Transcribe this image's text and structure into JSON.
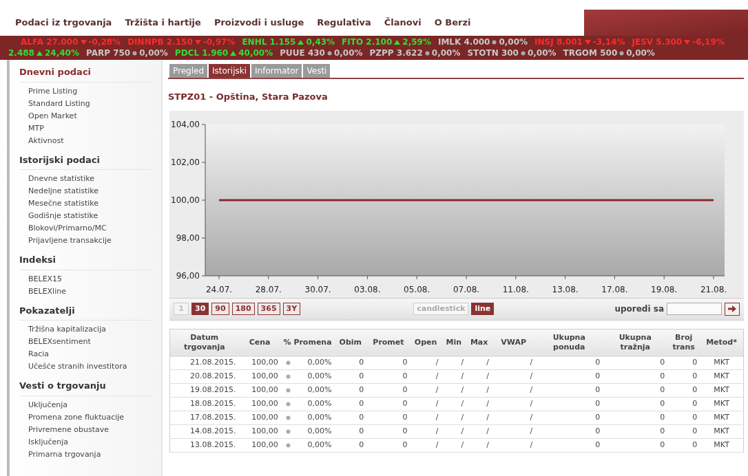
{
  "nav": [
    "Podaci iz trgovanja",
    "Tržišta i hartije",
    "Proizvodi i usluge",
    "Regulativa",
    "Članovi",
    "O Berzi"
  ],
  "ticker": [
    [
      {
        "name": "ALFA",
        "price": "27.000",
        "kind": "down",
        "change": "-0,28%"
      },
      {
        "name": "DINNPB",
        "price": "2.150",
        "kind": "down",
        "change": "-0,97%"
      },
      {
        "name": "ENHL",
        "price": "1.155",
        "kind": "up",
        "change": "0,43%"
      },
      {
        "name": "FITO",
        "price": "2.100",
        "kind": "up",
        "change": "2,59%"
      },
      {
        "name": "IMLK",
        "price": "4.000",
        "kind": "flat",
        "change": "0,00%"
      },
      {
        "name": "INSJ",
        "price": "8.001",
        "kind": "down",
        "change": "-3,14%"
      },
      {
        "name": "JESV",
        "price": "5.300",
        "kind": "down",
        "change": "-6,19%"
      }
    ],
    [
      {
        "price": "2.488",
        "kind": "up",
        "change": "24,40%"
      },
      {
        "name": "PARP",
        "price": "750",
        "kind": "flat",
        "change": "0,00%"
      },
      {
        "name": "PDCL",
        "price": "1.960",
        "kind": "up",
        "change": "40,00%"
      },
      {
        "name": "PUUE",
        "price": "430",
        "kind": "flat",
        "change": "0,00%"
      },
      {
        "name": "PZPP",
        "price": "3.622",
        "kind": "flat",
        "change": "0,00%"
      },
      {
        "name": "STOTN",
        "price": "300",
        "kind": "flat",
        "change": "0,00%"
      },
      {
        "name": "TRGOM",
        "price": "500",
        "kind": "flat",
        "change": "0,00%"
      }
    ]
  ],
  "sidebar": [
    {
      "title": "Dnevni podaci",
      "selected": true,
      "items": [
        "Prime Listing",
        "Standard Listing",
        "Open Market",
        "MTP",
        "Aktivnost"
      ]
    },
    {
      "title": "Istorijski podaci",
      "selected": false,
      "items": [
        "Dnevne statistike",
        "Nedeljne statistike",
        "Mesečne statistike",
        "Godišnje statistike",
        "Blokovi/Primarno/MC",
        "Prijavljene transakcije"
      ]
    },
    {
      "title": "Indeksi",
      "selected": false,
      "items": [
        "BELEX15",
        "BELEXline"
      ]
    },
    {
      "title": "Pokazatelji",
      "selected": false,
      "items": [
        "Tržišna kapitalizacija",
        "BELEXsentiment",
        "Racia",
        "Učešće stranih investitora"
      ]
    },
    {
      "title": "Vesti o trgovanju",
      "selected": false,
      "items": [
        "Uključenja",
        "Promena zone fluktuacije",
        "Privremene obustave",
        "Isključenja",
        "Primarna trgovanja"
      ]
    }
  ],
  "tabs": [
    {
      "label": "Pregled",
      "selected": false
    },
    {
      "label": "Istorijski",
      "selected": true
    },
    {
      "label": "Informator",
      "selected": false
    },
    {
      "label": "Vesti",
      "selected": false
    }
  ],
  "title": "STPZ01 - Opština, Stara Pazova",
  "chart": {
    "chart_data": {
      "type": "line",
      "categories": [
        "24.07.",
        "28.07.",
        "30.07.",
        "03.08.",
        "05.08.",
        "07.08.",
        "11.08.",
        "13.08.",
        "17.08.",
        "19.08.",
        "21.08."
      ],
      "series": [
        {
          "color": "#8b2c2c",
          "values": [
            100,
            100,
            100,
            100,
            100,
            100,
            100,
            100,
            100,
            100,
            100
          ]
        }
      ],
      "ylim": [
        96,
        104
      ],
      "yticks": [
        {
          "value": 96,
          "label": "96,00"
        },
        {
          "value": 98,
          "label": "98,00"
        },
        {
          "value": 100,
          "label": "100,00"
        },
        {
          "value": 102,
          "label": "102,00"
        },
        {
          "value": 104,
          "label": "104,00"
        }
      ]
    }
  },
  "periods": [
    {
      "label": "1",
      "selected": false,
      "disabled": true
    },
    {
      "label": "30",
      "selected": true,
      "disabled": false
    },
    {
      "label": "90",
      "selected": false,
      "disabled": false
    },
    {
      "label": "180",
      "selected": false,
      "disabled": false
    },
    {
      "label": "365",
      "selected": false,
      "disabled": false
    },
    {
      "label": "3Y",
      "selected": false,
      "disabled": false
    }
  ],
  "chart_types": [
    {
      "label": "candlestick",
      "selected": false
    },
    {
      "label": "line",
      "selected": true
    }
  ],
  "compare": {
    "label": "uporedi sa"
  },
  "table": {
    "columns": [
      "Datum trgovanja",
      "Cena",
      "% Promena",
      "Obim",
      "Promet",
      "Open",
      "Min",
      "Max",
      "VWAP",
      "Ukupna ponuda",
      "Ukupna tražnja",
      "Broj trans",
      "Metod*"
    ],
    "rows": [
      {
        "cells": [
          "21.08.2015.",
          "100,00",
          "0,00%",
          "0",
          "0",
          "/",
          "/",
          "/",
          "/",
          "0",
          "0",
          "0",
          "MKT"
        ],
        "kind": "flat"
      },
      {
        "cells": [
          "20.08.2015.",
          "100,00",
          "0,00%",
          "0",
          "0",
          "/",
          "/",
          "/",
          "/",
          "0",
          "0",
          "0",
          "MKT"
        ],
        "kind": "flat"
      },
      {
        "cells": [
          "19.08.2015.",
          "100,00",
          "0,00%",
          "0",
          "0",
          "/",
          "/",
          "/",
          "/",
          "0",
          "0",
          "0",
          "MKT"
        ],
        "kind": "flat"
      },
      {
        "cells": [
          "18.08.2015.",
          "100,00",
          "0,00%",
          "0",
          "0",
          "/",
          "/",
          "/",
          "/",
          "0",
          "0",
          "0",
          "MKT"
        ],
        "kind": "flat"
      },
      {
        "cells": [
          "17.08.2015.",
          "100,00",
          "0,00%",
          "0",
          "0",
          "/",
          "/",
          "/",
          "/",
          "0",
          "0",
          "0",
          "MKT"
        ],
        "kind": "flat"
      },
      {
        "cells": [
          "14.08.2015.",
          "100,00",
          "0,00%",
          "0",
          "0",
          "/",
          "/",
          "/",
          "/",
          "0",
          "0",
          "0",
          "MKT"
        ],
        "kind": "flat"
      },
      {
        "cells": [
          "13.08.2015.",
          "100,00",
          "0,00%",
          "0",
          "0",
          "/",
          "/",
          "/",
          "/",
          "0",
          "0",
          "0",
          "MKT"
        ],
        "kind": "flat"
      }
    ]
  }
}
